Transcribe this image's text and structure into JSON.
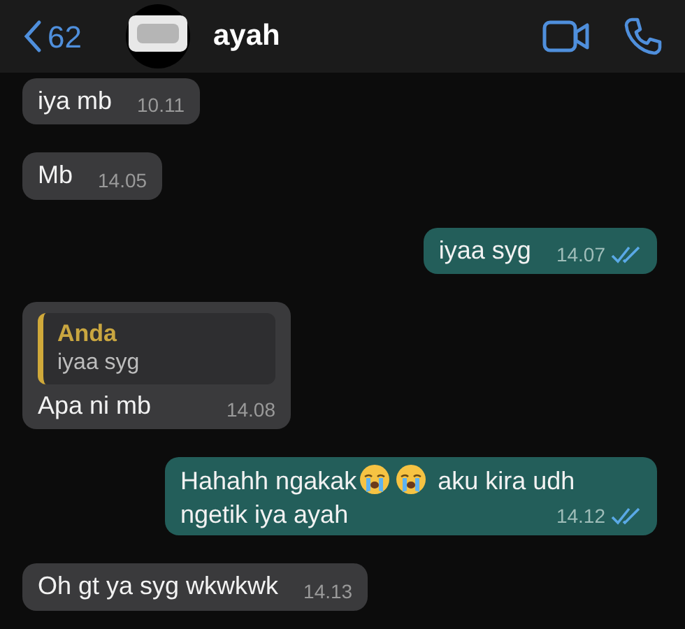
{
  "header": {
    "back_count": "62",
    "name": "ayah"
  },
  "messages": [
    {
      "kind": "in",
      "text": "iya mb",
      "time": "10.11"
    },
    {
      "kind": "in",
      "text": "Mb",
      "time": "14.05"
    },
    {
      "kind": "out",
      "text": "iyaa syg",
      "time": "14.07",
      "read": true
    },
    {
      "kind": "in",
      "quote": {
        "author": "Anda",
        "text": "iyaa syg"
      },
      "text": "Apa ni mb",
      "time": "14.08"
    },
    {
      "kind": "out",
      "parts": [
        {
          "kind": "text",
          "text": "Hahahh ngakak"
        },
        {
          "kind": "emoji"
        },
        {
          "kind": "emoji"
        },
        {
          "kind": "text",
          "text": "aku kira udh"
        },
        {
          "kind": "text",
          "text": "ngetik iya ayah"
        }
      ],
      "time": "14.12",
      "read": true
    },
    {
      "kind": "in",
      "text": "Oh gt ya syg wkwkwk",
      "time": "14.13"
    }
  ]
}
